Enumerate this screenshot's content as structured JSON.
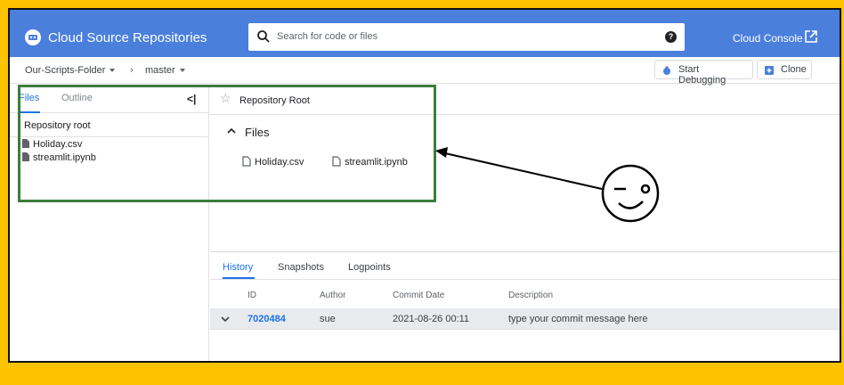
{
  "app": {
    "title": "Cloud Source Repositories",
    "console_label": "Cloud Console"
  },
  "search": {
    "placeholder": "Search for code or files"
  },
  "breadcrumb": {
    "folder": "Our-Scripts-Folder",
    "branch": "master"
  },
  "toolbar": {
    "debug_label": "Start Debugging",
    "clone_label": "Clone"
  },
  "sidebar": {
    "tabs": [
      "Files",
      "Outline"
    ],
    "collapse_symbol": "<|",
    "root_label": "Repository root",
    "files": [
      "Holiday.csv",
      "streamlit.ipynb"
    ]
  },
  "main": {
    "title": "Repository Root",
    "section_label": "Files",
    "files": [
      "Holiday.csv",
      "streamlit.ipynb"
    ]
  },
  "history": {
    "tabs": [
      "History",
      "Snapshots",
      "Logpoints"
    ],
    "columns": [
      "ID",
      "Author",
      "Commit Date",
      "Description"
    ],
    "rows": [
      {
        "id": "7020484",
        "author": "sue",
        "date": "2021-08-26 00:11",
        "description": "type your commit message here"
      }
    ]
  },
  "colors": {
    "background": "#FDC300",
    "appbar": "#4a7fdc",
    "accent": "#1a73e8",
    "annotation_box": "#3c7d3c"
  }
}
